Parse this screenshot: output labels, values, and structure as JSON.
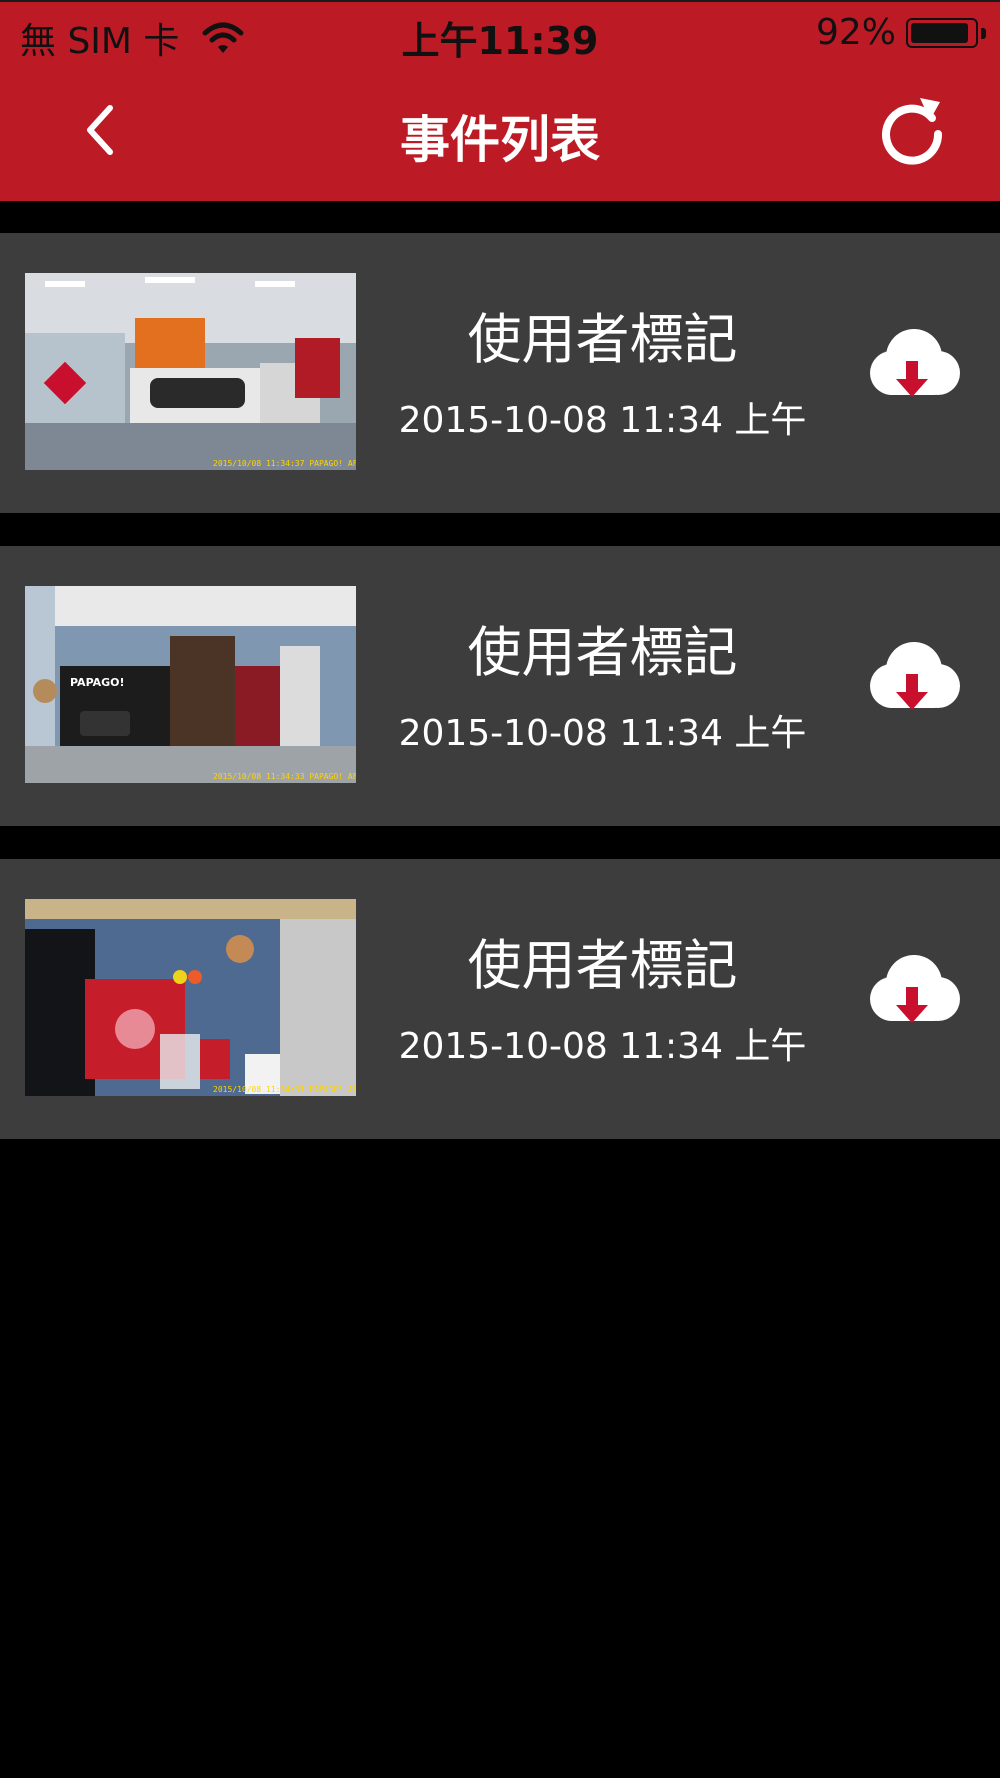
{
  "status_bar": {
    "carrier": "無 SIM 卡",
    "time": "上午11:39",
    "battery": "92%",
    "battery_level": 0.92,
    "wifi_icon": "wifi-icon",
    "battery_icon": "battery-icon"
  },
  "nav": {
    "title": "事件列表",
    "back_icon": "chevron-left-icon",
    "refresh_icon": "refresh-icon"
  },
  "events": [
    {
      "title": "使用者標記",
      "time": "2015-10-08 11:34 上午",
      "thumbnail_overlay": "2015/10/08 11:34:37 PAPAGO! AF",
      "download_icon": "cloud-download-icon"
    },
    {
      "title": "使用者標記",
      "time": "2015-10-08 11:34 上午",
      "thumbnail_overlay": "2015/10/08 11:34:33 PAPAGO! AF",
      "box_label": "PAPAGO!",
      "download_icon": "cloud-download-icon"
    },
    {
      "title": "使用者標記",
      "time": "2015-10-08 11:34 上午",
      "thumbnail_overlay": "2015/10/08 11:34:31 PAPAGO! AF",
      "download_icon": "cloud-download-icon"
    }
  ],
  "colors": {
    "header_bg": "#bc1b26",
    "item_bg": "#3d3d3d",
    "page_bg": "#000000",
    "download_arrow": "#c8102e"
  }
}
